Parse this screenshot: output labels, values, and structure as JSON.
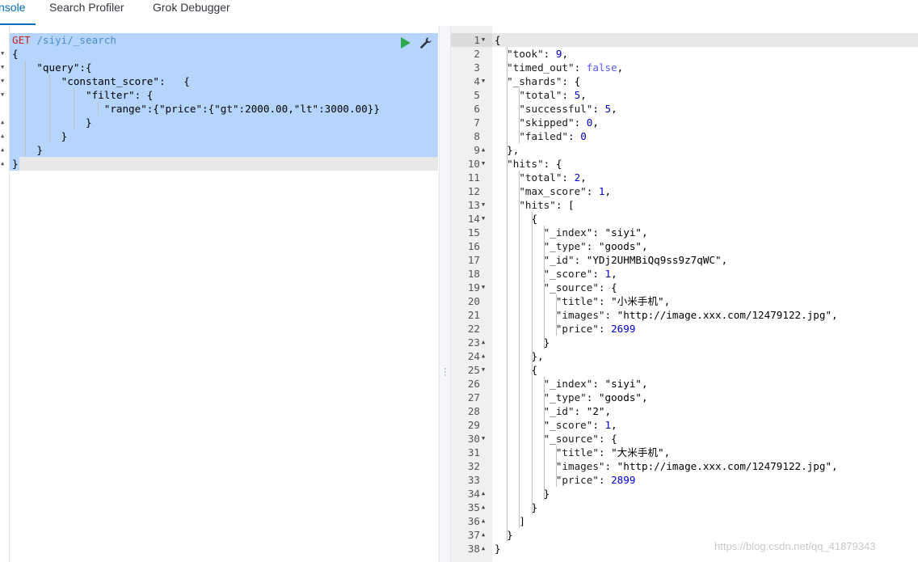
{
  "tabs": [
    {
      "label": "nsole",
      "active": true
    },
    {
      "label": "Search Profiler",
      "active": false
    },
    {
      "label": "Grok Debugger",
      "active": false
    }
  ],
  "request": {
    "method": "GET",
    "path": "/siyi/_search",
    "body_lines": [
      "{",
      "    \"query\":{",
      "        \"constant_score\":   {",
      "            \"filter\": {",
      "               \"range\":{\"price\":{\"gt\":2000.00,\"lt\":3000.00}}",
      "            }",
      "        }",
      "    }",
      "}"
    ],
    "run_icon": "play-icon",
    "settings_icon": "wrench-icon"
  },
  "response": {
    "line_numbers": [
      "1",
      "2",
      "3",
      "4",
      "5",
      "6",
      "7",
      "8",
      "9",
      "10",
      "11",
      "12",
      "13",
      "14",
      "15",
      "16",
      "17",
      "18",
      "19",
      "20",
      "21",
      "22",
      "23",
      "24",
      "25",
      "26",
      "27",
      "28",
      "29",
      "30",
      "31",
      "32",
      "33",
      "34",
      "35",
      "36",
      "37",
      "38"
    ],
    "lines": [
      "{",
      "  \"took\": 9,",
      "  \"timed_out\": false,",
      "  \"_shards\": {",
      "    \"total\": 5,",
      "    \"successful\": 5,",
      "    \"skipped\": 0,",
      "    \"failed\": 0",
      "  },",
      "  \"hits\": {",
      "    \"total\": 2,",
      "    \"max_score\": 1,",
      "    \"hits\": [",
      "      {",
      "        \"_index\": \"siyi\",",
      "        \"_type\": \"goods\",",
      "        \"_id\": \"YDj2UHMBiQq9ss9z7qWC\",",
      "        \"_score\": 1,",
      "        \"_source\": {",
      "          \"title\": \"小米手机\",",
      "          \"images\": \"http://image.xxx.com/12479122.jpg\",",
      "          \"price\": 2699",
      "        }",
      "      },",
      "      {",
      "        \"_index\": \"siyi\",",
      "        \"_type\": \"goods\",",
      "        \"_id\": \"2\",",
      "        \"_score\": 1,",
      "        \"_source\": {",
      "          \"title\": \"大米手机\",",
      "          \"images\": \"http://image.xxx.com/12479122.jpg\",",
      "          \"price\": 2899",
      "        }",
      "      }",
      "    ]",
      "  }",
      "}"
    ]
  },
  "watermark": "https://blog.csdn.net/qq_41879343",
  "colors": {
    "accent": "#006bb4",
    "selection": "#b5d5ff",
    "run": "#2fa84f"
  }
}
